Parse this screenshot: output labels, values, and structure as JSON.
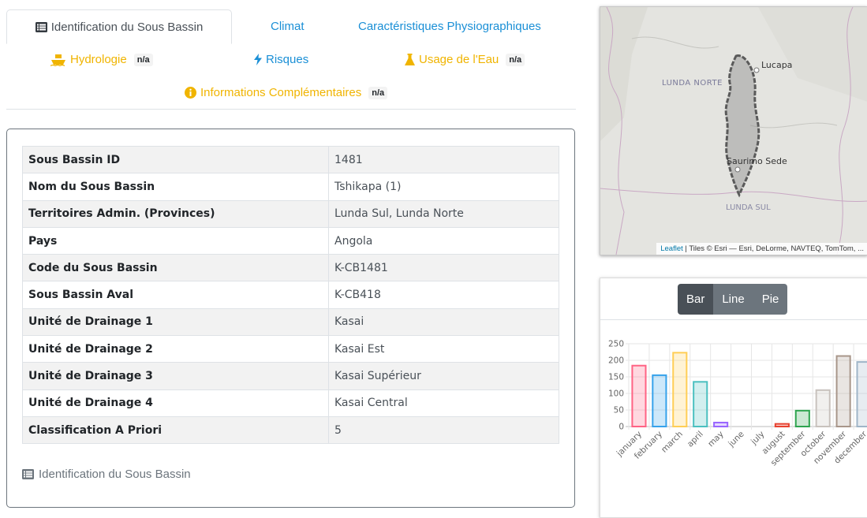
{
  "tabs": {
    "identification": "Identification du Sous Bassin",
    "climat": "Climat",
    "physio": "Caractéristiques Physiographiques",
    "hydrologie": "Hydrologie",
    "risques": "Risques",
    "usage": "Usage de l'Eau",
    "infos": "Informations Complémentaires",
    "na": "n/a"
  },
  "table": {
    "rows": [
      {
        "label": "Sous Bassin ID",
        "value": "1481"
      },
      {
        "label": "Nom du Sous Bassin",
        "value": "Tshikapa (1)"
      },
      {
        "label": "Territoires Admin. (Provinces)",
        "value": "Lunda Sul, Lunda Norte"
      },
      {
        "label": "Pays",
        "value": "Angola"
      },
      {
        "label": "Code du Sous Bassin",
        "value": "K-CB1481"
      },
      {
        "label": "Sous Bassin Aval",
        "value": "K-CB418"
      },
      {
        "label": "Unité de Drainage 1",
        "value": "Kasai"
      },
      {
        "label": "Unité de Drainage 2",
        "value": "Kasai Est"
      },
      {
        "label": "Unité de Drainage 3",
        "value": "Kasai Supérieur"
      },
      {
        "label": "Unité de Drainage 4",
        "value": "Kasai Central"
      },
      {
        "label": "Classification A Priori",
        "value": "5"
      }
    ],
    "caption": "Identification du Sous Bassin"
  },
  "map": {
    "labels": {
      "lucapa": "Lucapa",
      "lunda_norte": "LUNDA NORTE",
      "saurimo": "Saurimo Sede",
      "lunda_sul": "LUNDA SUL"
    },
    "attribution_link": "Leaflet",
    "attribution_text": " | Tiles © Esri — Esri, DeLorme, NAVTEQ, TomTom, ..."
  },
  "chart_buttons": {
    "bar": "Bar",
    "line": "Line",
    "pie": "Pie",
    "active": "bar"
  },
  "chart_data": {
    "type": "bar",
    "categories": [
      "january",
      "february",
      "march",
      "april",
      "may",
      "june",
      "july",
      "august",
      "september",
      "october",
      "november",
      "december"
    ],
    "values": [
      184,
      155,
      223,
      135,
      12,
      0,
      0,
      8,
      48,
      110,
      213,
      195
    ],
    "colors": [
      "#ff6384",
      "#36a2eb",
      "#ffce56",
      "#4bc0c0",
      "#9966ff",
      "#ff9f40",
      "#c9cbcf",
      "#e8412f",
      "#2ea44f",
      "#c8c2bd",
      "#a8968a",
      "#9fb5c8"
    ],
    "yticks": [
      0,
      50,
      100,
      150,
      200,
      250
    ],
    "ylim": [
      0,
      250
    ]
  }
}
